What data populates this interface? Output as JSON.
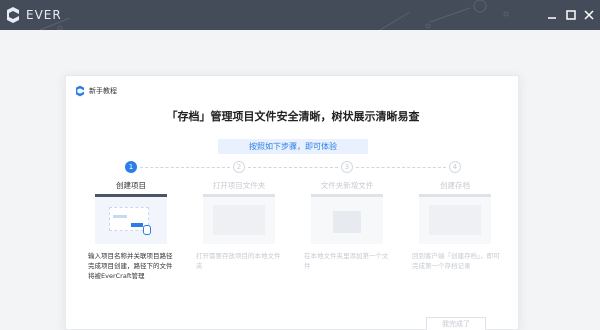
{
  "app": {
    "name": "EVER"
  },
  "window": {
    "minimize": "minimize",
    "maximize": "maximize",
    "close": "close"
  },
  "dialog": {
    "header": "新手教程",
    "title": "「存档」管理项目文件安全清晰，树状展示清晰易查",
    "pill": "按照如下步骤，即可体验",
    "steps": [
      {
        "num": "1",
        "label": "创建项目",
        "desc": "输入项目名称并关联项目路径完成项目创建，路径下的文件将被EverCraft管理",
        "state": "active"
      },
      {
        "num": "2",
        "label": "打开项目文件夹",
        "desc": "打开需要存放项目的本地文件夹",
        "state": "inactive"
      },
      {
        "num": "3",
        "label": "文件夹新增文件",
        "desc": "在本地文件夹里添加第一个文件",
        "state": "inactive"
      },
      {
        "num": "4",
        "label": "创建存档",
        "desc": "回到客户端「创建存档」，即可完成第一个存档记录",
        "state": "inactive"
      }
    ],
    "done_button": "我完成了"
  },
  "colors": {
    "titlebar": "#444c5a",
    "accent": "#2b7de9",
    "pill_bg": "#e8f1fd"
  },
  "icons": [
    "ever-logo-icon",
    "minimize-icon",
    "maximize-icon",
    "close-icon",
    "cursor-icon"
  ]
}
